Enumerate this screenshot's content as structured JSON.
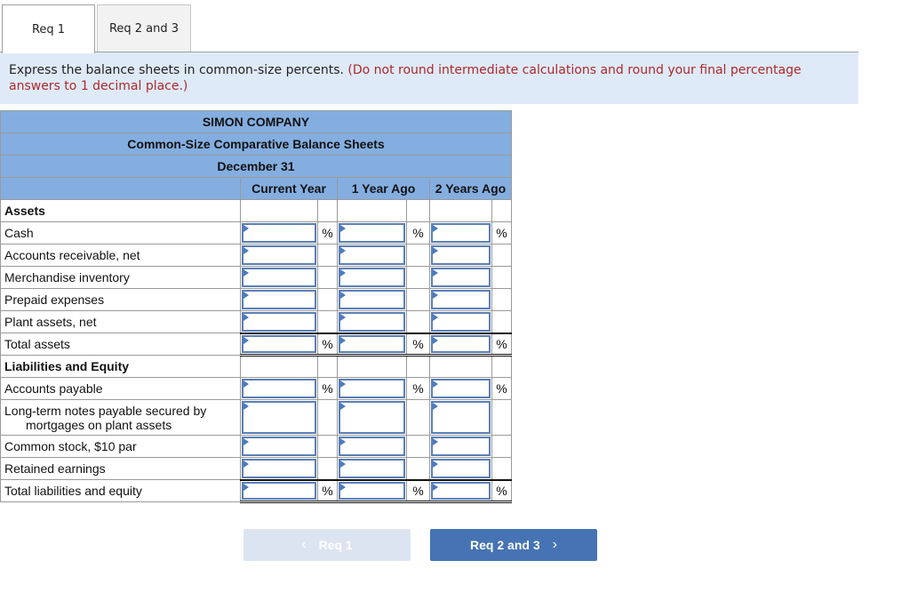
{
  "tabs": [
    {
      "label": "Req 1",
      "active": true
    },
    {
      "label": "Req 2 and 3",
      "active": false
    }
  ],
  "instructions": {
    "main": "Express the balance sheets in common-size percents.",
    "note": "(Do not round intermediate calculations and round your final percentage answers to 1 decimal place.)"
  },
  "table": {
    "company": "SIMON COMPANY",
    "title": "Common-Size Comparative Balance Sheets",
    "date": "December 31",
    "columns": [
      "Current Year",
      "1 Year Ago",
      "2 Years Ago"
    ],
    "percent_sign": "%",
    "rows": [
      {
        "label": "Assets",
        "type": "section"
      },
      {
        "label": "Cash",
        "type": "input",
        "pct": true,
        "values": [
          "",
          "",
          ""
        ]
      },
      {
        "label": "Accounts receivable, net",
        "type": "input",
        "pct": false,
        "values": [
          "",
          "",
          ""
        ]
      },
      {
        "label": "Merchandise inventory",
        "type": "input",
        "pct": false,
        "values": [
          "",
          "",
          ""
        ]
      },
      {
        "label": "Prepaid expenses",
        "type": "input",
        "pct": false,
        "values": [
          "",
          "",
          ""
        ]
      },
      {
        "label": "Plant assets, net",
        "type": "input",
        "pct": false,
        "values": [
          "",
          "",
          ""
        ]
      },
      {
        "label": "Total assets",
        "type": "total",
        "pct": true,
        "values": [
          "",
          "",
          ""
        ]
      },
      {
        "label": "Liabilities and Equity",
        "type": "section"
      },
      {
        "label": "Accounts payable",
        "type": "input",
        "pct": true,
        "values": [
          "",
          "",
          ""
        ]
      },
      {
        "label": "Long-term notes payable secured by",
        "label2": "mortgages on plant assets",
        "type": "input",
        "pct": false,
        "values": [
          "",
          "",
          ""
        ]
      },
      {
        "label": "Common stock, $10 par",
        "type": "input",
        "pct": false,
        "values": [
          "",
          "",
          ""
        ]
      },
      {
        "label": "Retained earnings",
        "type": "input",
        "pct": false,
        "values": [
          "",
          "",
          ""
        ]
      },
      {
        "label": "Total liabilities and equity",
        "type": "total",
        "pct": true,
        "values": [
          "",
          "",
          ""
        ]
      }
    ]
  },
  "nav": {
    "prev_label": "Req 1",
    "next_label": "Req 2 and 3",
    "prev_icon": "chevron-left-icon",
    "next_icon": "chevron-right-icon"
  },
  "colors": {
    "header_bg": "#84aee0",
    "instruction_bg": "#deeaf7",
    "note_red": "#b0282a",
    "next_button": "#4673b3",
    "prev_button_disabled": "#dbe4f0"
  }
}
